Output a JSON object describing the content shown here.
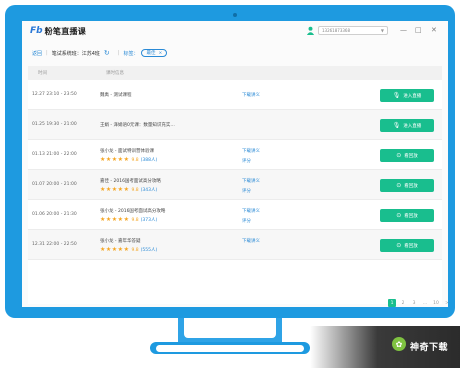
{
  "app": {
    "logo_icon": "Fb",
    "name": "粉笔直播课",
    "user_select_value": "13261873368",
    "window_buttons": [
      "—",
      "□",
      "✕"
    ]
  },
  "subbar": {
    "back": "返回",
    "course": "笔试系统班：江苏4班",
    "filter_label": "标签：",
    "tag": "最佳",
    "tag_close": "×"
  },
  "table": {
    "headers": {
      "time": "时间",
      "info": "课时信息"
    },
    "rows": [
      {
        "time": "12.27 23:10 - 23:50",
        "title": "魏禹 - 测试课程",
        "link1": "下载讲义",
        "link2": "",
        "rating": 0,
        "score": "",
        "count": "",
        "button": "进入直播",
        "button_icon": "mic-icon"
      },
      {
        "time": "01.25 19:30 - 21:00",
        "title": "王娟 - 泽娟语0元课：数量知识充实…",
        "link1": "",
        "link2": "",
        "rating": 0,
        "score": "",
        "count": "",
        "button": "进入直播",
        "button_icon": "mic-icon"
      },
      {
        "time": "01.13 21:00 - 22:00",
        "title": "张小龙 - 面试特训营体验课",
        "link1": "下载讲义",
        "link2": "评分",
        "rating": 5,
        "score": "9.8",
        "count": "(388人)",
        "button": "看回放",
        "button_icon": "play-icon"
      },
      {
        "time": "01.07 20:00 - 21:00",
        "title": "嘉佳 - 2016国考面试高分攻略",
        "link1": "下载讲义",
        "link2": "评分",
        "rating": 5,
        "score": "9.8",
        "count": "(343人)",
        "button": "看回放",
        "button_icon": "play-icon"
      },
      {
        "time": "01.06 20:00 - 21:30",
        "title": "张小龙 - 2016国考面试高分攻略",
        "link1": "下载讲义",
        "link2": "评分",
        "rating": 5,
        "score": "9.8",
        "count": "(373人)",
        "button": "看回放",
        "button_icon": "play-icon"
      },
      {
        "time": "12.31 22:00 - 22:50",
        "title": "张小龙 - 嘉年华答疑",
        "link1": "下载讲义",
        "link2": "",
        "rating": 5,
        "score": "9.8",
        "count": "(555人)",
        "button": "看回放",
        "button_icon": "play-icon"
      }
    ]
  },
  "pagination": [
    "1",
    "2",
    "3",
    "…",
    "10",
    ">"
  ],
  "watermark": {
    "logo": "✿",
    "text": "神奇下载"
  },
  "colors": {
    "frame": "#1e9ae0",
    "accent": "#2a8ad6",
    "button": "#19be8e",
    "star": "#f5a623"
  }
}
